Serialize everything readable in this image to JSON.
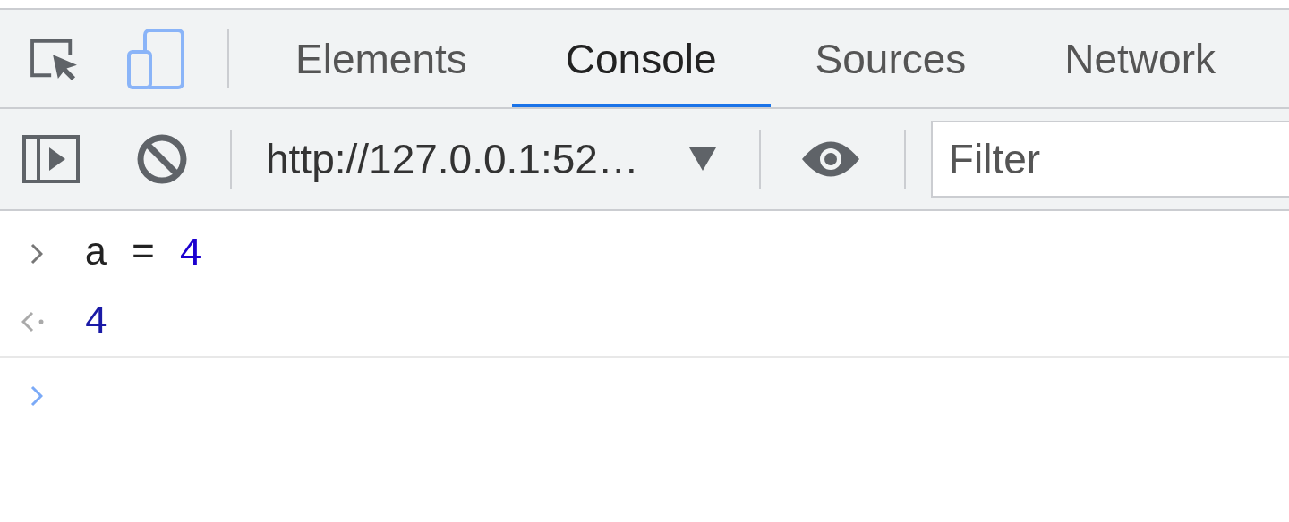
{
  "panel_bar": {
    "inspect_tool": {
      "active": false
    },
    "device_toolbar": {
      "active": true
    },
    "tabs": [
      {
        "label": "Elements",
        "selected": false
      },
      {
        "label": "Console",
        "selected": true
      },
      {
        "label": "Sources",
        "selected": false
      },
      {
        "label": "Network",
        "selected": false
      }
    ]
  },
  "console_toolbar": {
    "context": "http://127.0.0.1:52…",
    "filter": {
      "placeholder": "Filter"
    }
  },
  "console": {
    "entries": [
      {
        "kind": "input",
        "tokens": [
          {
            "text": "a",
            "color": "#222222"
          },
          {
            "text": " = ",
            "color": "#222222"
          },
          {
            "text": "4",
            "color": "#1c00cf"
          }
        ]
      },
      {
        "kind": "result",
        "text": "4"
      },
      {
        "kind": "prompt"
      }
    ]
  }
}
